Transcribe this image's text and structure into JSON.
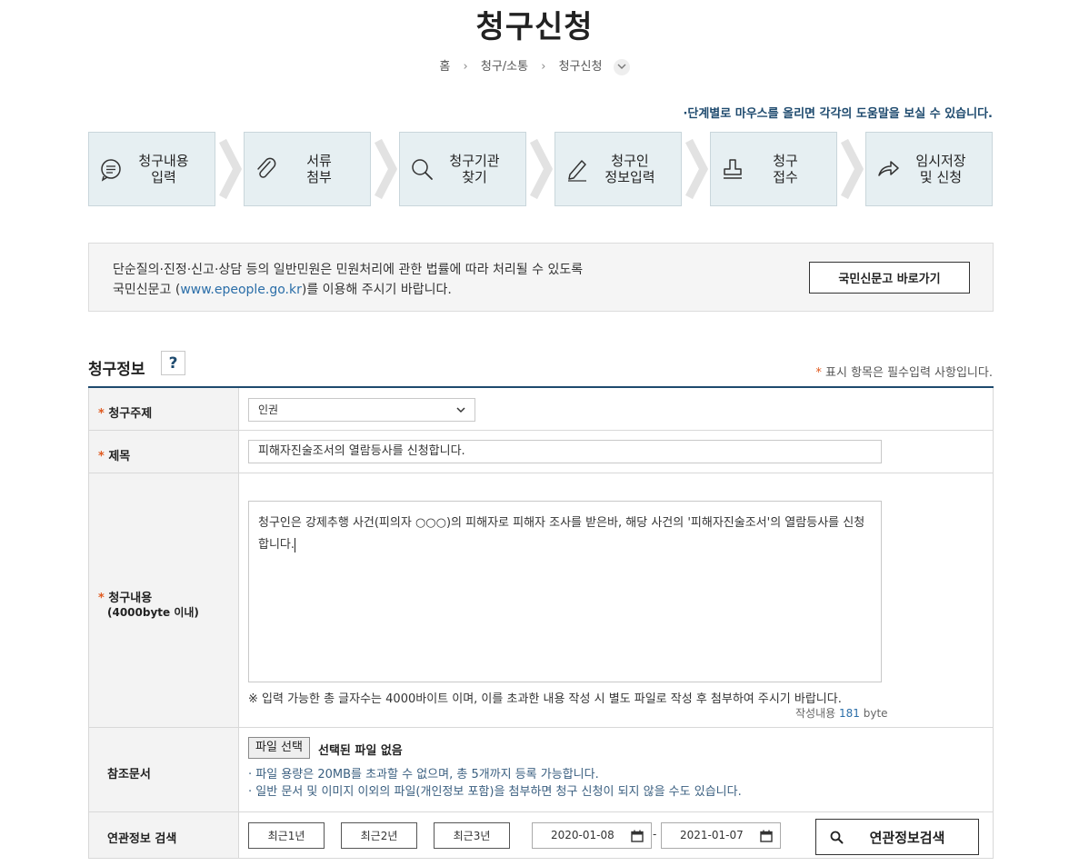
{
  "page": {
    "title": "청구신청",
    "breadcrumb": [
      "홈",
      "청구/소통",
      "청구신청"
    ],
    "help_hint": "·단계별로 마우스를 올리면 각각의 도움말을 보실 수 있습니다."
  },
  "steps": [
    {
      "label": "청구내용\n입력",
      "icon": "speech-bubble-icon"
    },
    {
      "label": "서류\n첨부",
      "icon": "paperclip-icon"
    },
    {
      "label": "청구기관\n찾기",
      "icon": "magnifier-icon"
    },
    {
      "label": "청구인\n정보입력",
      "icon": "pencil-icon"
    },
    {
      "label": "청구\n접수",
      "icon": "stamp-icon"
    },
    {
      "label": "임시저장\n및 신청",
      "icon": "share-arrow-icon"
    }
  ],
  "notice": {
    "line1": "단순질의·진정·신고·상담 등의 일반민원은 민원처리에 관한 법률에 따라 처리될 수 있도록",
    "line2_prefix": "국민신문고 (",
    "line2_link": "www.epeople.go.kr",
    "line2_suffix": ")를 이용해 주시기 바랍니다.",
    "button": "국민신문고 바로가기"
  },
  "section": {
    "title": "청구정보",
    "help_button": "?",
    "required_star": "*",
    "required_note": "표시 항목은 필수입력 사항입니다."
  },
  "form": {
    "subject": {
      "label": "청구주제",
      "value": "인권"
    },
    "title": {
      "label": "제목",
      "value": "피해자진술조서의 열람등사를 신청합니다."
    },
    "content": {
      "label": "청구내용",
      "sublabel": "(4000byte 이내)",
      "value": "청구인은 강제추행 사건(피의자 ○○○)의 피해자로 피해자 조사를 받은바, 해당 사건의 '피해자진술조서'의 열람등사를 신청합니다.",
      "limit_note": "※ 입력 가능한 총 글자수는 4000바이트 이며, 이를 초과한 내용 작성 시 별도 파일로 작성 후 첨부하여 주시기 바랍니다.",
      "byte_prefix": "작성내용",
      "byte_count": "181",
      "byte_unit": "byte"
    },
    "attachment": {
      "label": "참조문서",
      "button": "파일 선택",
      "status": "선택된 파일 없음",
      "note1": "· 파일 용량은 20MB를 초과할 수 없으며, 총 5개까지 등록 가능합니다.",
      "note2": "· 일반 문서 및 이미지 이외의 파일(개인정보 포함)을 첨부하면 청구 신청이 되지 않을 수도 있습니다."
    },
    "related_search": {
      "label": "연관정보 검색",
      "periods": [
        "최근1년",
        "최근2년",
        "최근3년"
      ],
      "date_from": "2020-01-08",
      "date_sep": "-",
      "date_to": "2021-01-07",
      "button": "연관정보검색"
    }
  },
  "colors": {
    "accent": "#1e4a6e",
    "required": "#e05a20",
    "step_bg": "#e6eff2",
    "link": "#2b6ea8"
  }
}
